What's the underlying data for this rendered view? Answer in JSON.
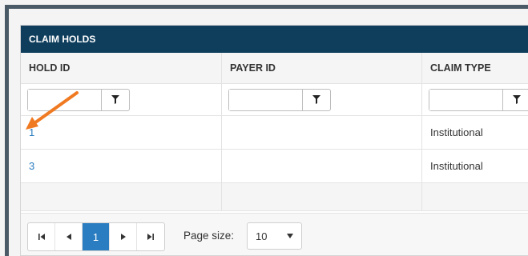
{
  "panel": {
    "title": "CLAIM HOLDS"
  },
  "columns": [
    "HOLD ID",
    "PAYER ID",
    "CLAIM TYPE"
  ],
  "filter_icon": "filter-icon",
  "rows": [
    {
      "hold_id": "1",
      "payer_id": "",
      "claim_type": "Institutional"
    },
    {
      "hold_id": "3",
      "payer_id": "",
      "claim_type": "Institutional"
    }
  ],
  "pager": {
    "first_icon": "first-page-icon",
    "prev_icon": "prev-page-icon",
    "current_page": "1",
    "next_icon": "next-page-icon",
    "last_icon": "last-page-icon",
    "page_size_label": "Page size:",
    "page_size_value": "10"
  },
  "annotation": {
    "color": "#f07a22"
  }
}
